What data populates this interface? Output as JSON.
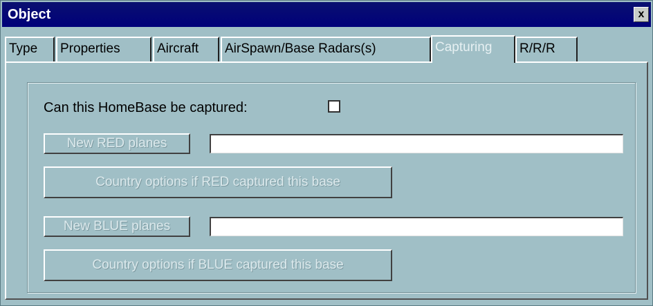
{
  "window": {
    "title": "Object",
    "close_label": "x"
  },
  "tabs": [
    {
      "label": "Type",
      "active": false
    },
    {
      "label": "Properties",
      "active": false
    },
    {
      "label": "Aircraft",
      "active": false
    },
    {
      "label": "AirSpawn/Base Radars(s)",
      "active": false
    },
    {
      "label": "Capturing",
      "active": true
    },
    {
      "label": "R/R/R",
      "active": false
    }
  ],
  "capturing": {
    "can_capture_label": "Can this HomeBase be captured:",
    "can_capture_checked": false,
    "new_red_button": "New RED planes",
    "new_red_value": "",
    "red_options_button": "Country options if RED captured this base",
    "new_blue_button": "New BLUE planes",
    "new_blue_value": "",
    "blue_options_button": "Country options if BLUE captured this base"
  }
}
